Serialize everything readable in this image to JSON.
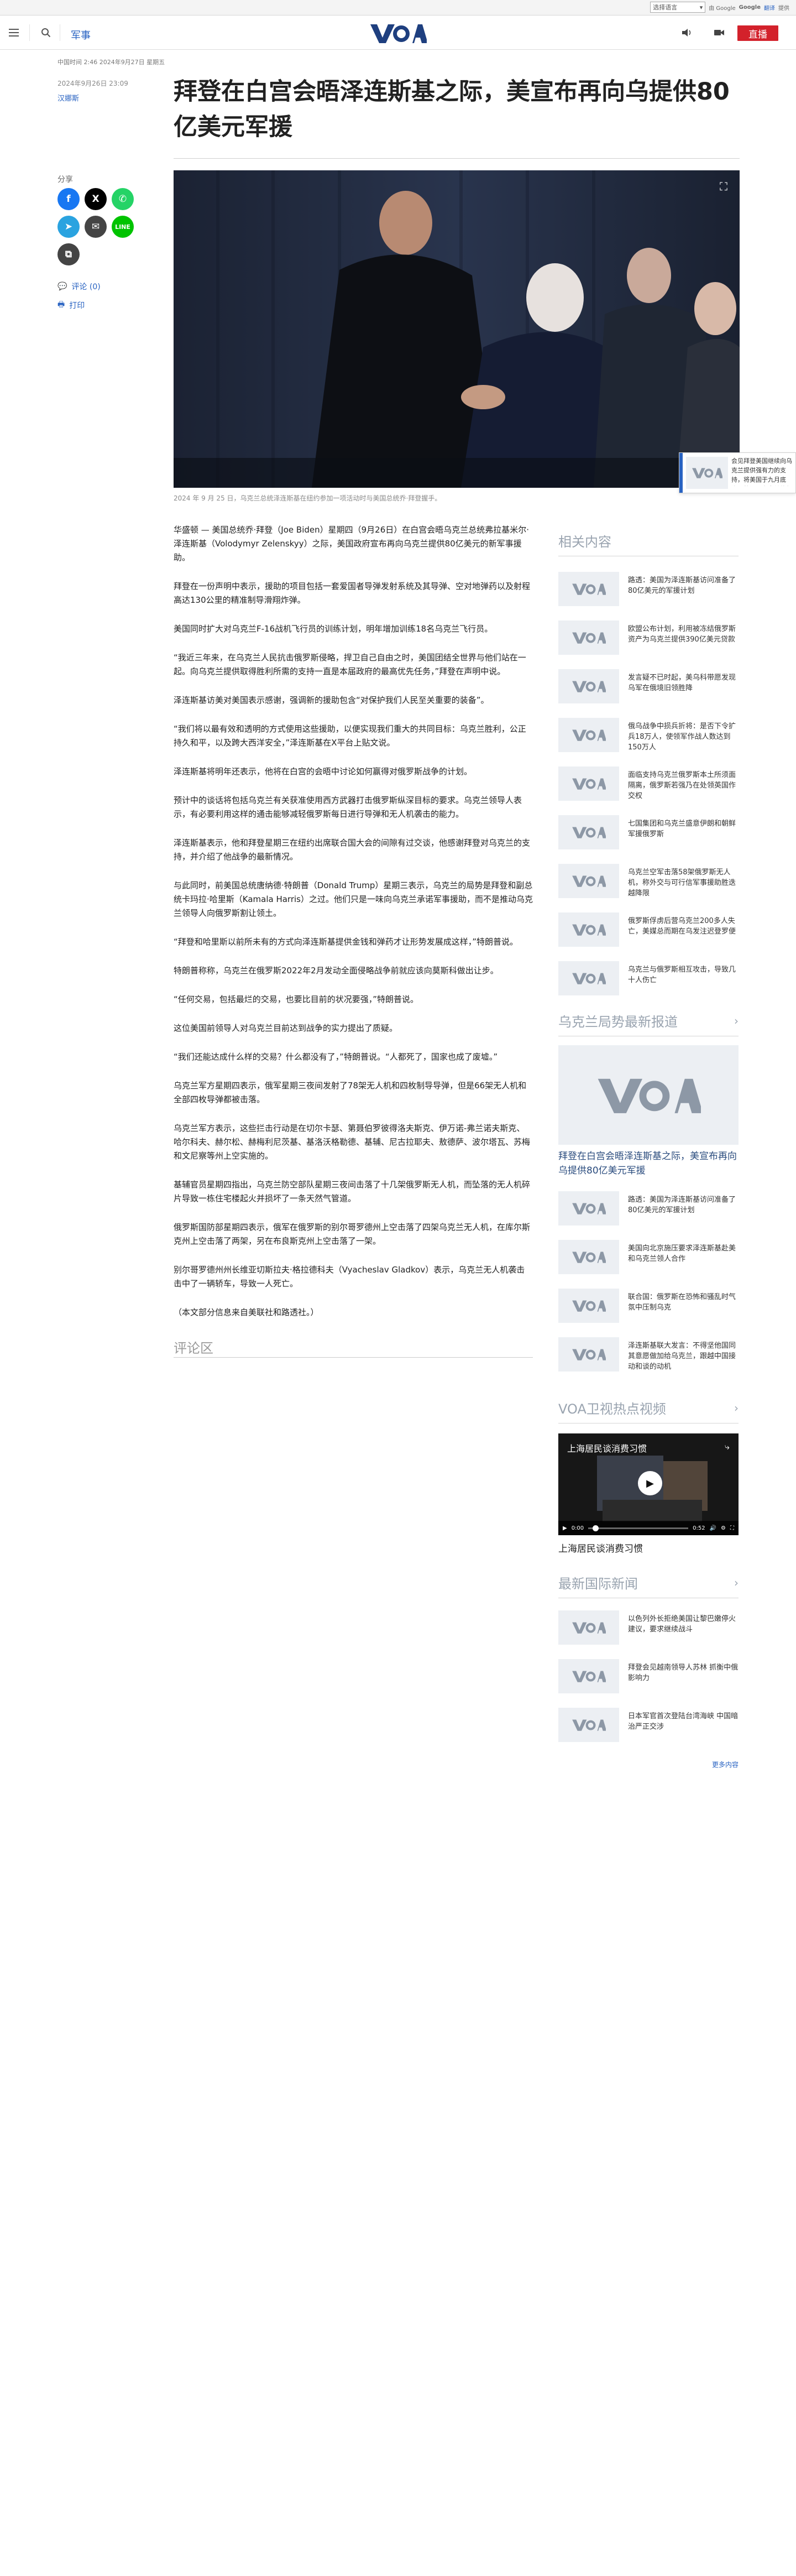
{
  "translate": {
    "language_select": "选择语言",
    "powered_by": "由 Google",
    "translate_label": "翻译",
    "brand": "Google",
    "service": "提供"
  },
  "header": {
    "section": "军事",
    "live_label": "直播",
    "logo_text": "VOA"
  },
  "article": {
    "meta_top": "中国时间 2:46 2024年9月27日 星期五",
    "date": "2024年9月26日 23:09",
    "author": "汉娜斯",
    "title": "拜登在白宫会晤泽连斯基之际，美宣布再向乌提供80亿美元军援",
    "caption": "2024 年 9 月 25 日，乌克兰总统泽连斯基在纽约参加一项活动时与美国总统乔·拜登握手。",
    "paragraphs": [
      "华盛顿 — 美国总统乔·拜登（Joe Biden）星期四（9月26日）在白宫会晤乌克兰总统弗拉基米尔·泽连斯基（Volodymyr Zelenskyy）之际，美国政府宣布再向乌克兰提供80亿美元的新军事援助。",
      "拜登在一份声明中表示，援助的项目包括一套爱国者导弹发射系统及其导弹、空对地弹药以及射程高达130公里的精准制导滑翔炸弹。",
      "美国同时扩大对乌克兰F-16战机飞行员的训练计划，明年增加训练18名乌克兰飞行员。",
      "“我近三年来，在乌克兰人民抗击俄罗斯侵略，捍卫自己自由之时，美国团结全世界与他们站在一起。向乌克兰提供取得胜利所需的支持一直是本届政府的最高优先任务，”拜登在声明中说。",
      "泽连斯基访美对美国表示感谢，强调新的援助包含“对保护我们人民至关重要的装备”。",
      "“我们将以最有效和透明的方式使用这些援助，以便实现我们重大的共同目标：乌克兰胜利，公正持久和平，以及跨大西洋安全，”泽连斯基在X平台上贴文说。",
      "泽连斯基将明年还表示，他将在白宫的会晤中讨论如何赢得对俄罗斯战争的计划。",
      "预计中的谈话将包括乌克兰有关获准使用西方武器打击俄罗斯纵深目标的要求。乌克兰领导人表示，有必要利用这样的通击能够减轻俄罗斯每日进行导弹和无人机袭击的能力。",
      "泽连斯基表示，他和拜登星期三在纽约出席联合国大会的间隙有过交谈，他感谢拜登对乌克兰的支持，并介绍了他战争的最新情况。",
      "与此同时，前美国总统唐纳德·特朗普（Donald Trump）星期三表示，乌克兰的局势是拜登和副总统卡玛拉·哈里斯（Kamala Harris）之过。他们只是一味向乌克兰承诺军事援助，而不是推动乌克兰领导人向俄罗斯割让领土。",
      "“拜登和哈里斯以前所未有的方式向泽连斯基提供金钱和弹药才让形势发展成这样，”特朗普说。",
      "特朗普称称，乌克兰在俄罗斯2022年2月发动全面侵略战争前就应该向莫斯科做出让步。",
      "“任何交易，包括最烂的交易，也要比目前的状况要强，”特朗普说。",
      "这位美国前领导人对乌克兰目前达到战争的实力提出了质疑。",
      "“我们还能达成什么样的交易？什么都没有了，”特朗普说。“人都死了，国家也成了废墟。”",
      "乌克兰军方星期四表示，俄军星期三夜间发射了78架无人机和四枚制导导弹，但是66架无人机和全部四枚导弹都被击落。",
      "乌克兰军方表示，这些拦击行动是在切尔卡瑟、第聂伯罗彼得洛夫斯克、伊万诺-弗兰诺夫斯克、哈尔科夫、赫尔松、赫梅利尼茨基、基洛沃格勒德、基辅、尼古拉耶夫、敖德萨、波尔塔瓦、苏梅和文尼察等州上空实施的。",
      "基辅官员星期四指出，乌克兰防空部队星期三夜间击落了十几架俄罗斯无人机，而坠落的无人机碎片导致一栋住宅楼起火并损坏了一条天然气管道。",
      "俄罗斯国防部星期四表示，俄军在俄罗斯的别尔哥罗德州上空击落了四架乌克兰无人机，在库尔斯克州上空击落了两架，另在布良斯克州上空击落了一架。",
      "别尔哥罗德州州长维亚切斯拉夫·格拉德科夫（Vyacheslav Gladkov）表示，乌克兰无人机袭击击中了一辆轿车，导致一人死亡。",
      "（本文部分信息来自美联社和路透社。）"
    ],
    "comments_heading": "评论区"
  },
  "share": {
    "label": "分享",
    "comment_link": "评论 (0)",
    "print_link": "打印"
  },
  "float_card": {
    "text": "会见拜登美国继续向乌克兰提供强有力的支持，将美国于九月底告，将阐明乌克兰的长远发展策略"
  },
  "related": {
    "heading": "相关内容",
    "items": [
      "路透：美国为泽连斯基访问准备了80亿美元的军援计划",
      "欧盟公布计划，利用被冻结俄罗斯资产为乌克兰提供390亿美元贷款",
      "发言疑不已时起，美乌科带愿发现乌军在俄境旧领胜降",
      "俄乌战争中损兵折将：是否下令扩兵18万人，使领军作战人数达到150万人",
      "面临支持乌克兰俄罗斯本土所须面隔离，俄罗斯若强乃在处领英国作交权",
      "七国集团和乌克兰盛意伊朗和朝鲜军援俄罗斯",
      "乌克兰空军击落58架俄罗斯无人机，称外交与可行信军事援助胜迭越降限",
      "俄罗斯俘虏后营乌克兰200多人失亡，美媒总而期在乌发注迟登罗便",
      "乌克兰与俄罗斯相互攻击，导致几十人伤亡"
    ]
  },
  "ukraine": {
    "heading": "乌克兰局势最新报道",
    "big_title": "拜登在白宫会晤泽连斯基之际，美宣布再向乌提供80亿美元军援",
    "items": [
      "路透：美国为泽连斯基访问准备了80亿美元的军援计划",
      "美国向北京施压要求泽连斯基赴美和乌克兰领人合作",
      "联合国：俄罗斯在恐怖和骚乱时气氛中压制乌克",
      "泽连斯基联大发言：不得坚他国同其意愿做加给乌克兰，跟越中国接动和谈的动机"
    ]
  },
  "video": {
    "heading": "VOA卫视热点视频",
    "title": "上海居民谈消费习惯",
    "current_time": "0:00",
    "duration": "0:52",
    "caption": "上海居民谈消费习惯"
  },
  "intl": {
    "heading": "最新国际新闻",
    "items": [
      "以色列外长拒绝美国让黎巴嫩停火建议，要求继续战斗",
      "拜登会见越南领导人苏林 抓衡中俄影响力",
      "日本军官首次登陆台湾海峡 中国暗治严正交涉"
    ],
    "more": "更多内容"
  },
  "colors": {
    "accent": "#2963c2",
    "live": "#d3212b",
    "logo": "#1e3f7f"
  }
}
